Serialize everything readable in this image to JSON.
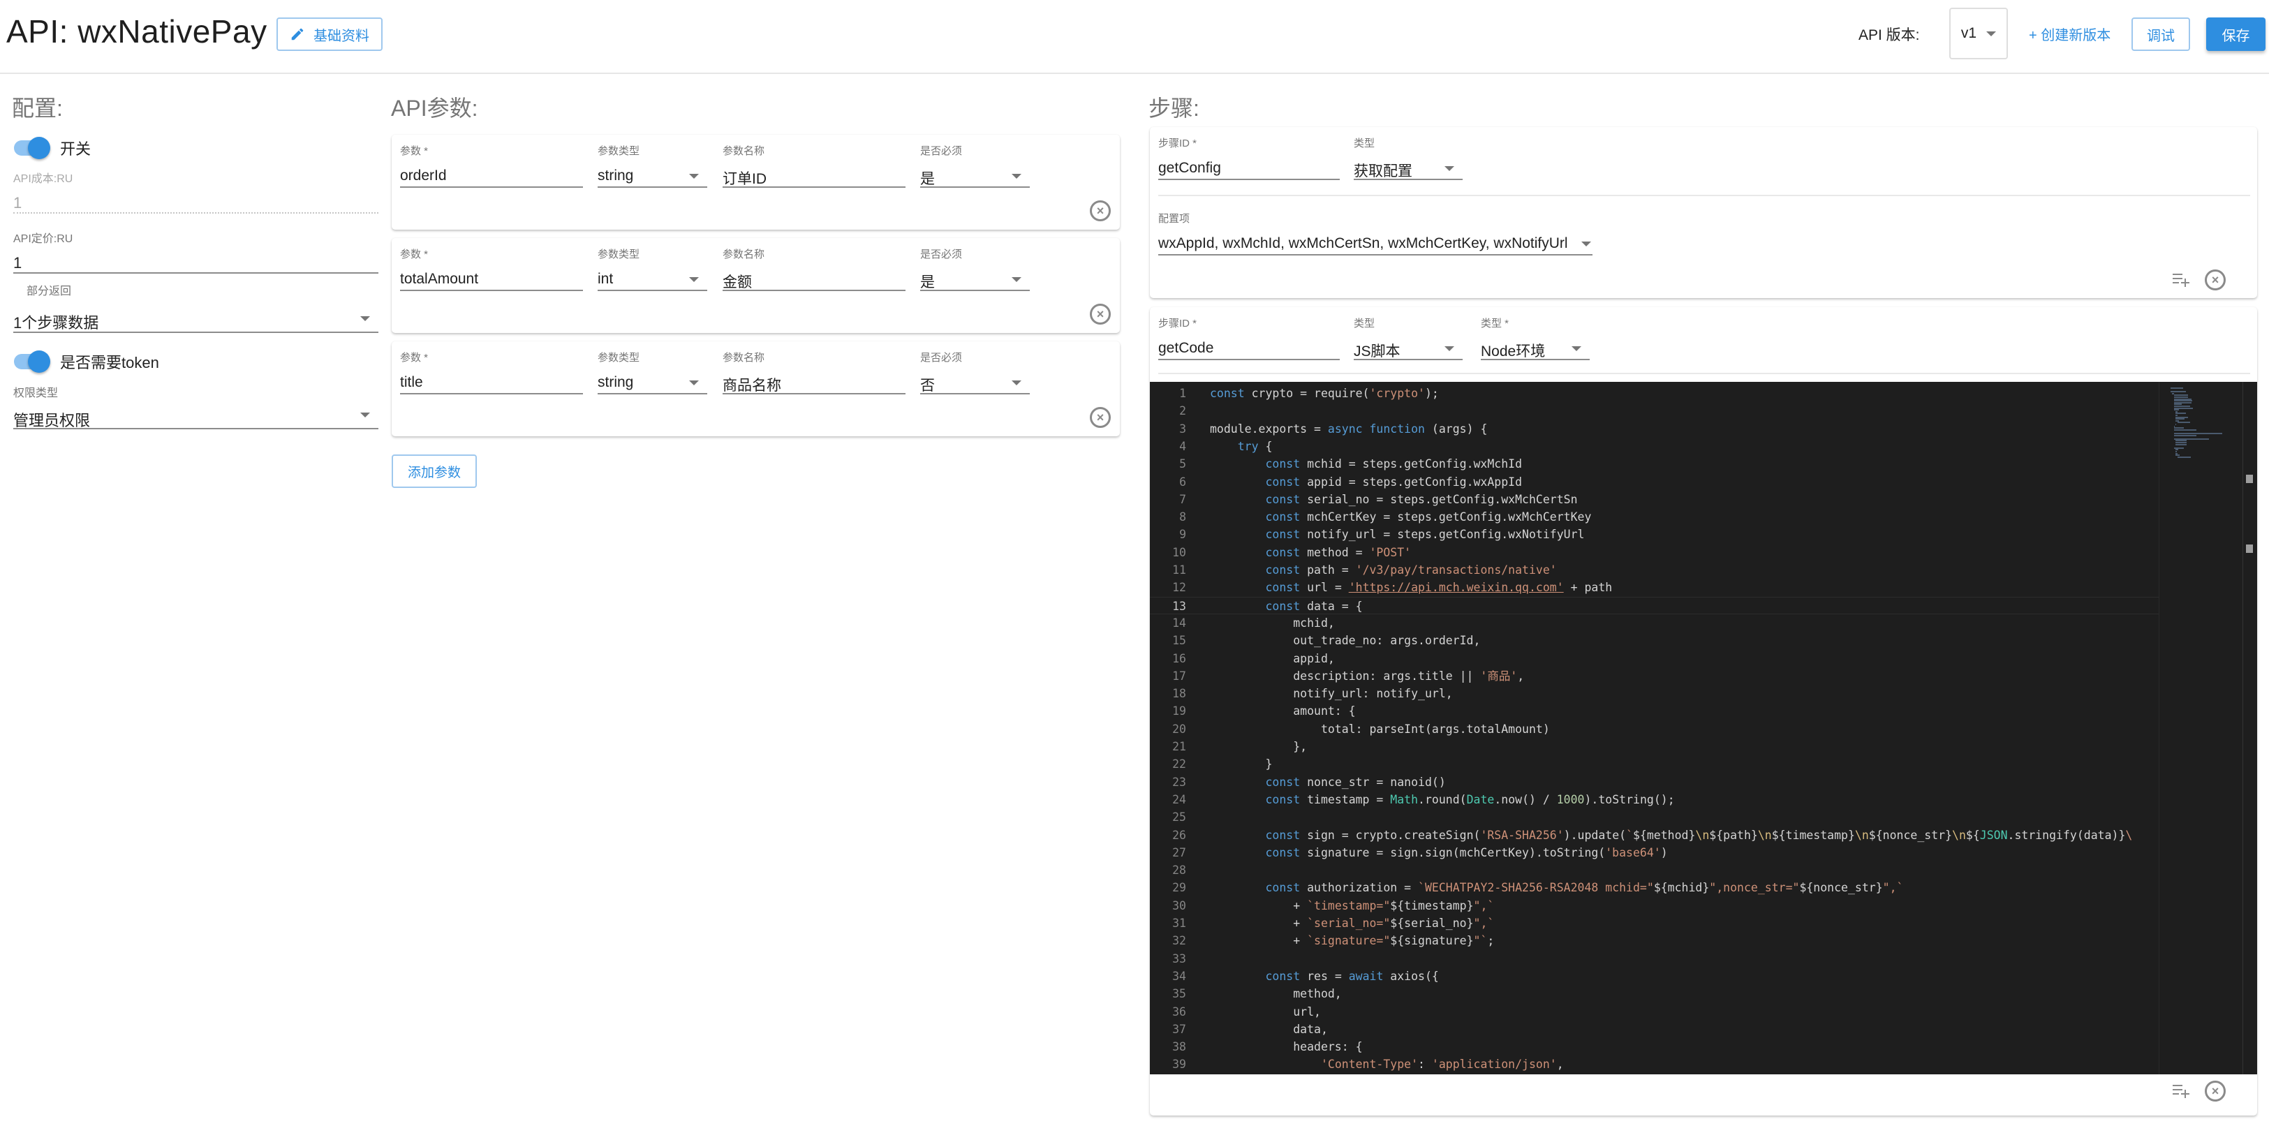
{
  "header": {
    "title": "API: wxNativePay",
    "basic_info_button": "基础资料",
    "version_label": "API 版本:",
    "version_value": "v1",
    "create_version_link": "+ 创建新版本",
    "debug_button": "调试",
    "save_button": "保存"
  },
  "config": {
    "title": "配置:",
    "switch_label": "开关",
    "switch_on": true,
    "cost_label": "API成本:RU",
    "cost_value": "1",
    "price_label": "API定价:RU",
    "price_value": "1",
    "partial_return_label": "部分返回",
    "partial_return_value": "1个步骤数据",
    "token_label": "是否需要token",
    "token_on": true,
    "permission_label": "权限类型",
    "permission_value": "管理员权限"
  },
  "params": {
    "title": "API参数:",
    "labels": {
      "param": "参数 *",
      "type": "参数类型",
      "name": "参数名称",
      "required": "是否必须"
    },
    "rows": [
      {
        "param": "orderId",
        "type": "string",
        "name": "订单ID",
        "required": "是"
      },
      {
        "param": "totalAmount",
        "type": "int",
        "name": "金额",
        "required": "是"
      },
      {
        "param": "title",
        "type": "string",
        "name": "商品名称",
        "required": "否"
      }
    ],
    "add_button": "添加参数"
  },
  "steps": {
    "title": "步骤:",
    "items": [
      {
        "id_label": "步骤ID *",
        "id_value": "getConfig",
        "type_label": "类型",
        "type_value": "获取配置",
        "config_label": "配置项",
        "config_value": "wxAppId, wxMchId, wxMchCertSn, wxMchCertKey, wxNotifyUrl"
      },
      {
        "id_label": "步骤ID *",
        "id_value": "getCode",
        "type_label": "类型",
        "type_value": "JS脚本",
        "env_label": "类型 *",
        "env_value": "Node环境"
      }
    ]
  },
  "editor": {
    "current_line": 13,
    "lines": [
      "const crypto = require('crypto');",
      "",
      "module.exports = async function (args) {",
      "    try {",
      "        const mchid = steps.getConfig.wxMchId",
      "        const appid = steps.getConfig.wxAppId",
      "        const serial_no = steps.getConfig.wxMchCertSn",
      "        const mchCertKey = steps.getConfig.wxMchCertKey",
      "        const notify_url = steps.getConfig.wxNotifyUrl",
      "        const method = 'POST'",
      "        const path = '/v3/pay/transactions/native'",
      "        const url = 'https://api.mch.weixin.qq.com' + path",
      "        const data = {",
      "            mchid,",
      "            out_trade_no: args.orderId,",
      "            appid,",
      "            description: args.title || '商品',",
      "            notify_url: notify_url,",
      "            amount: {",
      "                total: parseInt(args.totalAmount)",
      "            },",
      "        }",
      "        const nonce_str = nanoid()",
      "        const timestamp = Math.round(Date.now() / 1000).toString();",
      "",
      "        const sign = crypto.createSign('RSA-SHA256').update(`${method}\\n${path}\\n${timestamp}\\n${nonce_str}\\n${JSON.stringify(data)}\\",
      "        const signature = sign.sign(mchCertKey).toString('base64')",
      "",
      "        const authorization = `WECHATPAY2-SHA256-RSA2048 mchid=\"${mchid}\",nonce_str=\"${nonce_str}\",`",
      "            + `timestamp=\"${timestamp}\",`",
      "            + `serial_no=\"${serial_no}\",`",
      "            + `signature=\"${signature}\"`;",
      "",
      "        const res = await axios({",
      "            method,",
      "            url,",
      "            data,",
      "            headers: {",
      "                'Content-Type': 'application/json',"
    ]
  },
  "colors": {
    "accent": "#2e8ee0",
    "editor_bg": "#1e1e1e",
    "keyword": "#569cd6",
    "string": "#ce9178"
  }
}
